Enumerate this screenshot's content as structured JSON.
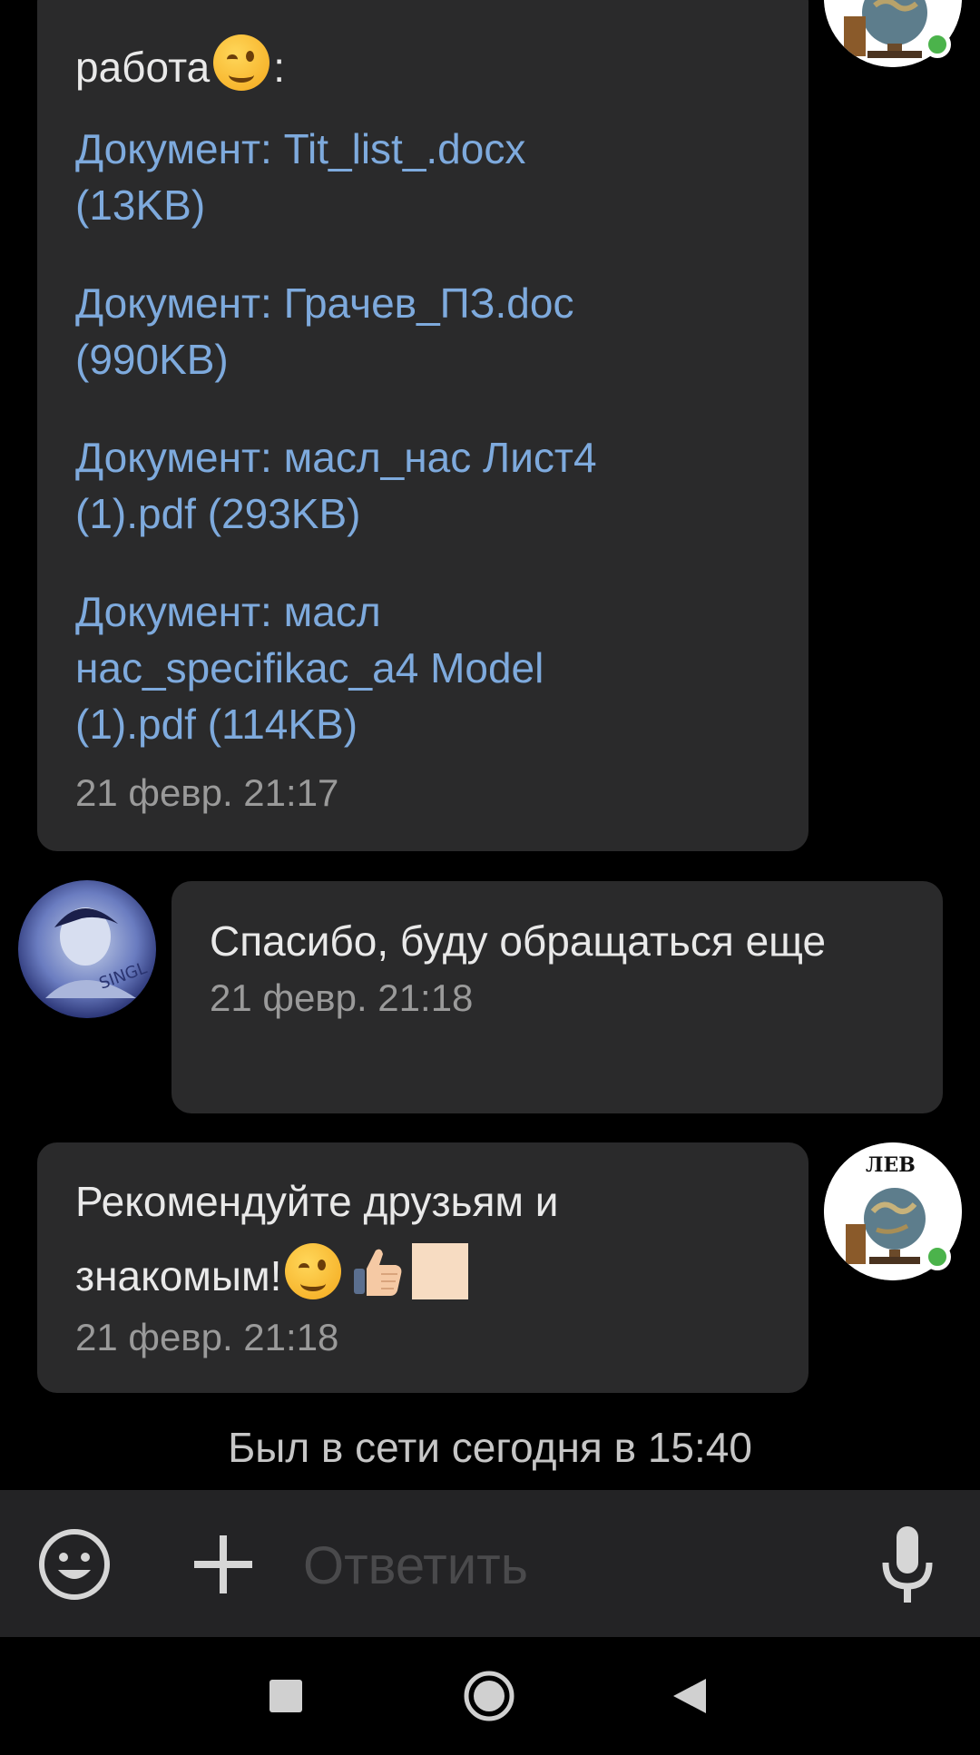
{
  "messages": {
    "first_outgoing": {
      "lead_text": "работа",
      "lead_suffix": ":",
      "documents": [
        {
          "line1": "Документ: Tit_list_.docx",
          "line2": "(13KB)"
        },
        {
          "line1": "Документ: Грачев_ПЗ.doc",
          "line2": "(990KB)"
        },
        {
          "line1": "Документ: масл_нас Лист4",
          "line2": "(1).pdf (293KB)"
        },
        {
          "line1": "Документ: масл",
          "line2": "нас_specifikac_a4 Model",
          "line3": "(1).pdf (114KB)"
        }
      ],
      "timestamp": "21 февр. 21:17"
    },
    "incoming": {
      "text": "Спасибо, буду обращаться еще",
      "timestamp": "21 февр. 21:18"
    },
    "second_outgoing": {
      "line1": "Рекомендуйте друзьям и",
      "line2": "знакомым!",
      "timestamp": "21 февр. 21:18"
    }
  },
  "avatars": {
    "own_label": "ЛЕВ"
  },
  "status": {
    "last_seen": "Был в сети сегодня в 15:40"
  },
  "composer": {
    "placeholder": "Ответить"
  },
  "colors": {
    "background": "#000000",
    "bubble": "#2a2a2b",
    "link": "#7eaadd",
    "online": "#4bb34b"
  }
}
